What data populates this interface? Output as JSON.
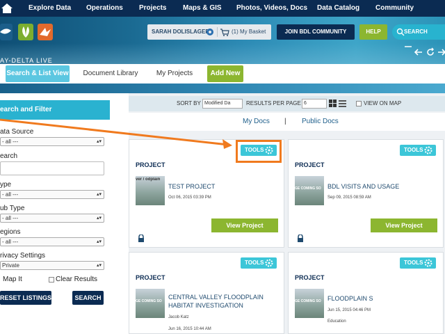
{
  "topnav": {
    "items": [
      "Explore Data",
      "Operations",
      "Projects",
      "Maps & GIS",
      "Photos, Videos, Docs",
      "Data Catalog",
      "Community"
    ]
  },
  "header": {
    "logo_text": "AY-DELTA LIVE",
    "user_name": "SARAH DOLISLAGER",
    "basket_label": "(1) My Basket",
    "join_label": "JOIN BDL COMMUNITY",
    "help_label": "HELP",
    "search_placeholder": "SEARCH"
  },
  "tabs": [
    {
      "label": "Search & List View",
      "active": true
    },
    {
      "label": "Document Library",
      "active": false
    },
    {
      "label": "My Projects",
      "active": false
    },
    {
      "label": "Add New",
      "active": false
    }
  ],
  "sidebar": {
    "title": "earch and Filter",
    "data_source_label": "ata Source",
    "data_source_value": "- all ---",
    "search_label": "earch",
    "type_label": "ype",
    "type_value": "- all ---",
    "sub_type_label": "ub Type",
    "sub_type_value": "- all ---",
    "regions_label": "egions",
    "regions_value": "- all ---",
    "privacy_label": "rivacy Settings",
    "privacy_value": "Private",
    "map_it_label": "Map It",
    "clear_results_label": "Clear Results",
    "reset_label": "RESET LISTINGS",
    "search_button": "SEARCH"
  },
  "toolbar": {
    "sort_by_label": "SORT BY",
    "sort_value": "Modified Da",
    "results_per_page_label": "RESULTS PER PAGE",
    "results_per_page_value": "6",
    "view_on_map_label": "VIEW ON MAP"
  },
  "doc_tabs": {
    "my_docs": "My Docs",
    "separator": "|",
    "public_docs": "Public Docs"
  },
  "cards": [
    {
      "tools": "TOOLS",
      "type": "PROJECT",
      "title": "TEST PROJECT",
      "date": "Oct 06, 2015 03:39 PM",
      "thumb_text": "ver / odplain",
      "button": "View Project"
    },
    {
      "tools": "TOOLS",
      "type": "PROJECT",
      "title": "BDL VISITS AND USAGE",
      "date": "Sep 09, 2015 08:59 AM",
      "thumb_text": "GE COMING SO",
      "button": "View Project"
    },
    {
      "tools": "TOOLS",
      "type": "PROJECT",
      "title": "CENTRAL VALLEY FLOODPLAIN HABITAT INVESTIGATION",
      "author": "Jacob Katz",
      "date": "Jun 16, 2015 10:44 AM",
      "thumb_text": "GE COMING SO"
    },
    {
      "tools": "TOOLS",
      "type": "PROJECT",
      "title": "FLOODPLAIN S",
      "date": "Jun 15, 2015 04:46 PM",
      "category": "Education",
      "thumb_text": "GE COMING SO"
    }
  ],
  "colors": {
    "nav_dark": "#0b2b52",
    "accent_cyan": "#2ab2d0",
    "accent_green": "#8cb630",
    "annotation_orange": "#f07a1e"
  }
}
